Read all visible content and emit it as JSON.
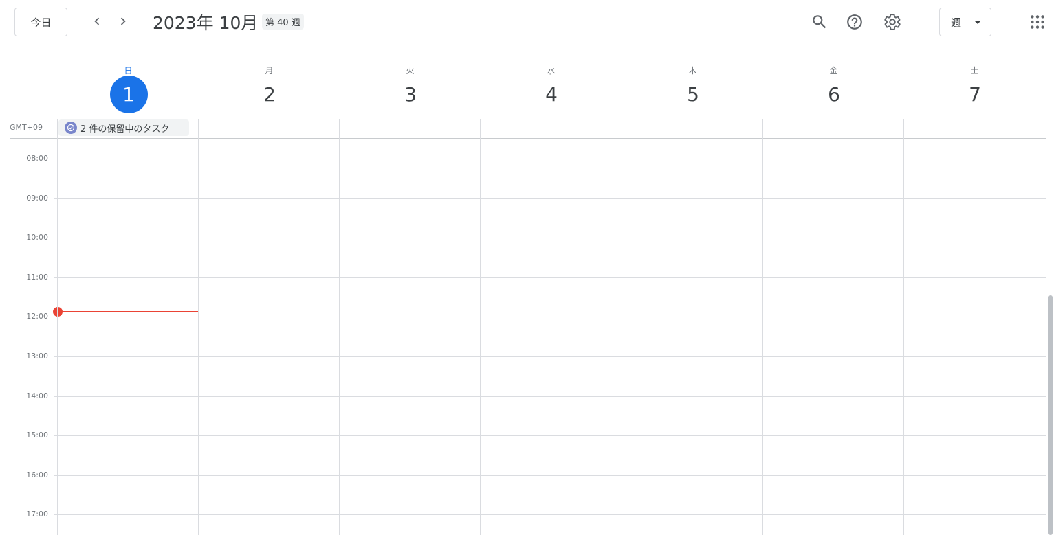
{
  "header": {
    "today_label": "今日",
    "title": "2023年 10月",
    "week_badge": "第 40 週",
    "view_label": "週"
  },
  "days": [
    {
      "dow": "日",
      "num": "1",
      "today": true
    },
    {
      "dow": "月",
      "num": "2"
    },
    {
      "dow": "火",
      "num": "3"
    },
    {
      "dow": "水",
      "num": "4"
    },
    {
      "dow": "木",
      "num": "5"
    },
    {
      "dow": "金",
      "num": "6"
    },
    {
      "dow": "土",
      "num": "7"
    }
  ],
  "timezone_label": "GMT+09",
  "pending_tasks_label": "2 件の保留中のタスク",
  "hours": [
    "08:00",
    "09:00",
    "10:00",
    "11:00",
    "12:00",
    "13:00",
    "14:00",
    "15:00",
    "16:00",
    "17:00"
  ],
  "colors": {
    "accent": "#1a73e8",
    "now_indicator": "#ea4335",
    "task_icon": "#7986cb",
    "grid_line": "#dadce0"
  },
  "icons": {
    "prev": "chevron-left-icon",
    "next": "chevron-right-icon",
    "search": "search-icon",
    "help": "help-icon",
    "settings": "gear-icon",
    "view_caret": "caret-down-icon",
    "apps": "apps-grid-icon",
    "task": "task-check-icon"
  }
}
